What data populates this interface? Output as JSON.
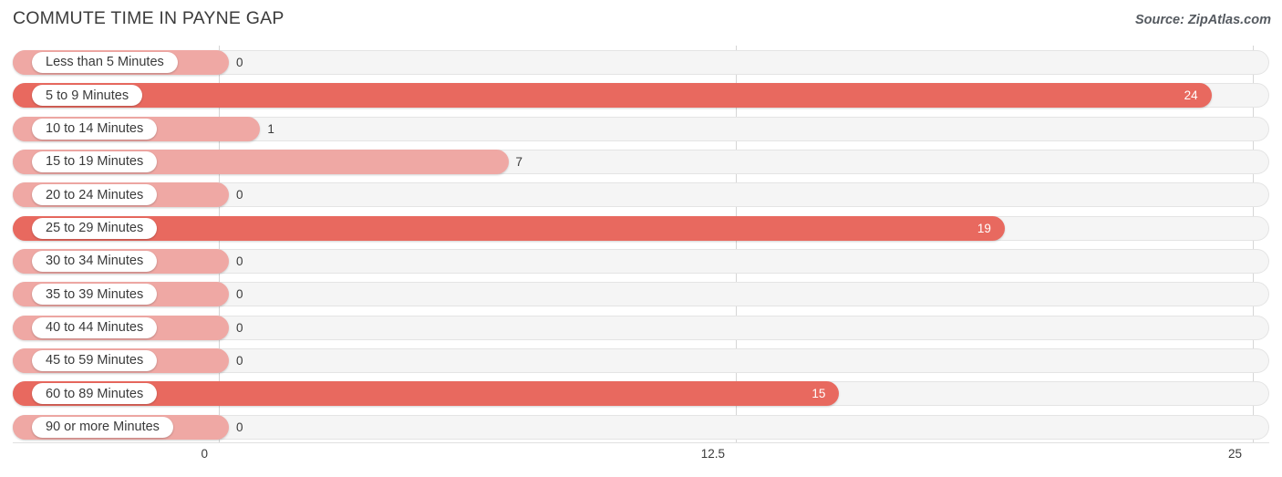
{
  "header": {
    "title": "COMMUTE TIME IN PAYNE GAP",
    "source": "Source: ZipAtlas.com"
  },
  "colors": {
    "bar_light": "#efa8a4",
    "bar_dark": "#e8695f",
    "track": "#f5f5f5",
    "track_border": "#e4e4e4",
    "gridline": "#d5d5d5",
    "label_text": "#3a3a3a",
    "title_text": "#3c3c3c"
  },
  "chart_data": {
    "type": "bar",
    "orientation": "horizontal",
    "title": "COMMUTE TIME IN PAYNE GAP",
    "xlabel": "",
    "ylabel": "",
    "xlim": [
      0,
      25
    ],
    "grid": true,
    "legend": null,
    "tick_labels": [
      "0",
      "12.5",
      "25"
    ],
    "tick_values": [
      0,
      12.5,
      25
    ],
    "categories": [
      "Less than 5 Minutes",
      "5 to 9 Minutes",
      "10 to 14 Minutes",
      "15 to 19 Minutes",
      "20 to 24 Minutes",
      "25 to 29 Minutes",
      "30 to 34 Minutes",
      "35 to 39 Minutes",
      "40 to 44 Minutes",
      "45 to 59 Minutes",
      "60 to 89 Minutes",
      "90 or more Minutes"
    ],
    "values": [
      0,
      24,
      1,
      7,
      0,
      19,
      0,
      0,
      0,
      0,
      15,
      0
    ],
    "value_labels": [
      "0",
      "24",
      "1",
      "7",
      "0",
      "19",
      "0",
      "0",
      "0",
      "0",
      "15",
      "0"
    ]
  }
}
